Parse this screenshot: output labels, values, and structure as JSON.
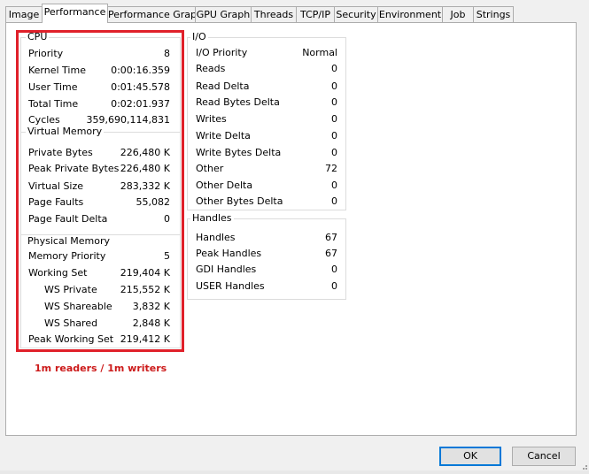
{
  "tabs": [
    "Image",
    "Performance",
    "Performance Graph",
    "GPU Graph",
    "Threads",
    "TCP/IP",
    "Security",
    "Environment",
    "Job",
    "Strings"
  ],
  "active_tab": "Performance",
  "cpu": {
    "title": "CPU",
    "rows": [
      {
        "label": "Priority",
        "value": "8"
      },
      {
        "label": "Kernel Time",
        "value": "0:00:16.359"
      },
      {
        "label": "User Time",
        "value": "0:01:45.578"
      },
      {
        "label": "Total Time",
        "value": "0:02:01.937"
      },
      {
        "label": "Cycles",
        "value": "359,690,114,831"
      }
    ]
  },
  "virtual_memory": {
    "title": "Virtual Memory",
    "rows": [
      {
        "label": "Private Bytes",
        "value": "226,480 K"
      },
      {
        "label": "Peak Private Bytes",
        "value": "226,480 K"
      },
      {
        "label": "Virtual Size",
        "value": "283,332 K"
      },
      {
        "label": "Page Faults",
        "value": "55,082"
      },
      {
        "label": "Page Fault Delta",
        "value": "0"
      }
    ]
  },
  "physical_memory": {
    "title": "Physical Memory",
    "rows": [
      {
        "label": "Memory Priority",
        "value": "5"
      },
      {
        "label": "Working Set",
        "value": "219,404 K"
      },
      {
        "label": "WS Private",
        "value": "215,552 K"
      },
      {
        "label": "WS Shareable",
        "value": "3,832 K"
      },
      {
        "label": "WS Shared",
        "value": "2,848 K"
      },
      {
        "label": "Peak Working Set",
        "value": "219,412 K"
      }
    ]
  },
  "io": {
    "title": "I/O",
    "rows": [
      {
        "label": "I/O Priority",
        "value": "Normal"
      },
      {
        "label": "Reads",
        "value": "0"
      },
      {
        "label": "Read Delta",
        "value": "0"
      },
      {
        "label": "Read Bytes Delta",
        "value": "0"
      },
      {
        "label": "Writes",
        "value": "0"
      },
      {
        "label": "Write Delta",
        "value": "0"
      },
      {
        "label": "Write Bytes Delta",
        "value": "0"
      },
      {
        "label": "Other",
        "value": "72"
      },
      {
        "label": "Other Delta",
        "value": "0"
      },
      {
        "label": "Other Bytes Delta",
        "value": "0"
      }
    ]
  },
  "handles": {
    "title": "Handles",
    "rows": [
      {
        "label": "Handles",
        "value": "67"
      },
      {
        "label": "Peak Handles",
        "value": "67"
      },
      {
        "label": "GDI Handles",
        "value": "0"
      },
      {
        "label": "USER Handles",
        "value": "0"
      }
    ]
  },
  "annotation": "1m readers / 1m writers",
  "buttons": {
    "ok": "OK",
    "cancel": "Cancel"
  },
  "colors": {
    "annotation": "#e0202a",
    "default_button_border": "#0078d7"
  }
}
